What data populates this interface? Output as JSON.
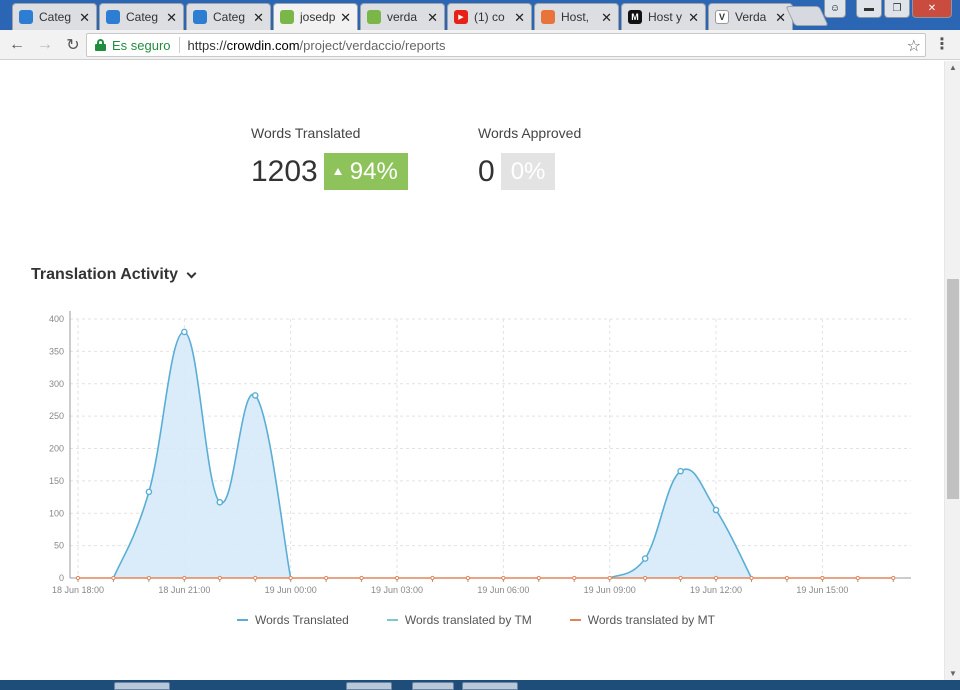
{
  "browser": {
    "tabs": [
      {
        "title": "Categ",
        "icon": "crowdin-brain-icon",
        "color": "#2d7dd2",
        "active": false
      },
      {
        "title": "Categ",
        "icon": "crowdin-brain-icon",
        "color": "#2d7dd2",
        "active": false
      },
      {
        "title": "Categ",
        "icon": "crowdin-brain-icon",
        "color": "#2d7dd2",
        "active": false
      },
      {
        "title": "josedp",
        "icon": "verdaccio-leaf-icon",
        "color": "#7ab648",
        "active": true
      },
      {
        "title": "verda",
        "icon": "verdaccio-leaf-icon",
        "color": "#7ab648",
        "active": false
      },
      {
        "title": "(1) co",
        "icon": "youtube-icon",
        "color": "#e62117",
        "active": false
      },
      {
        "title": "Host, ",
        "icon": "host-icon",
        "color": "#e8743b",
        "active": false
      },
      {
        "title": "Host y",
        "icon": "medium-icon",
        "color": "#111111",
        "active": false
      },
      {
        "title": "Verda",
        "icon": "verdaccio-v-icon",
        "color": "#ffffff",
        "active": false
      }
    ],
    "close_glyph": "✕",
    "secure_label": "Es seguro",
    "url_scheme": "https://",
    "url_host": "crowdin.com",
    "url_path": "/project/verdaccio/reports"
  },
  "stats": {
    "translated": {
      "label": "Words Translated",
      "value": "1203",
      "badge": "94%"
    },
    "approved": {
      "label": "Words Approved",
      "value": "0",
      "badge": "0%"
    }
  },
  "section": {
    "title": "Translation Activity"
  },
  "chart_data": {
    "type": "area",
    "ylim": [
      0,
      400
    ],
    "yticks": [
      0,
      50,
      100,
      150,
      200,
      250,
      300,
      350,
      400
    ],
    "xtick_labels": [
      "18 Jun 18:00",
      "18 Jun 21:00",
      "19 Jun 00:00",
      "19 Jun 03:00",
      "19 Jun 06:00",
      "19 Jun 09:00",
      "19 Jun 12:00",
      "19 Jun 15:00"
    ],
    "xlim_hours": [
      0,
      23.5
    ],
    "series": [
      {
        "name": "Words Translated",
        "color": "#5aaed6",
        "x": [
          0,
          1,
          2,
          3,
          4,
          5,
          6,
          7,
          8,
          9,
          10,
          11,
          12,
          13,
          14,
          15,
          16,
          17,
          18,
          19,
          20,
          21,
          22,
          23
        ],
        "values": [
          0,
          0,
          133,
          380,
          117,
          282,
          0,
          0,
          0,
          0,
          0,
          0,
          0,
          0,
          0,
          0,
          30,
          165,
          105,
          0,
          0,
          0,
          0,
          0
        ]
      },
      {
        "name": "Words translated by TM",
        "color": "#7ec8c8",
        "values": []
      },
      {
        "name": "Words translated by MT",
        "color": "#e0855a",
        "x": [
          0,
          1,
          2,
          3,
          4,
          5,
          6,
          7,
          8,
          9,
          10,
          11,
          12,
          13,
          14,
          15,
          16,
          17,
          18,
          19,
          20,
          21,
          22,
          23
        ],
        "values": [
          0,
          0,
          0,
          0,
          0,
          0,
          0,
          0,
          0,
          0,
          0,
          0,
          0,
          0,
          0,
          0,
          0,
          0,
          0,
          0,
          0,
          0,
          0,
          0
        ]
      }
    ]
  }
}
